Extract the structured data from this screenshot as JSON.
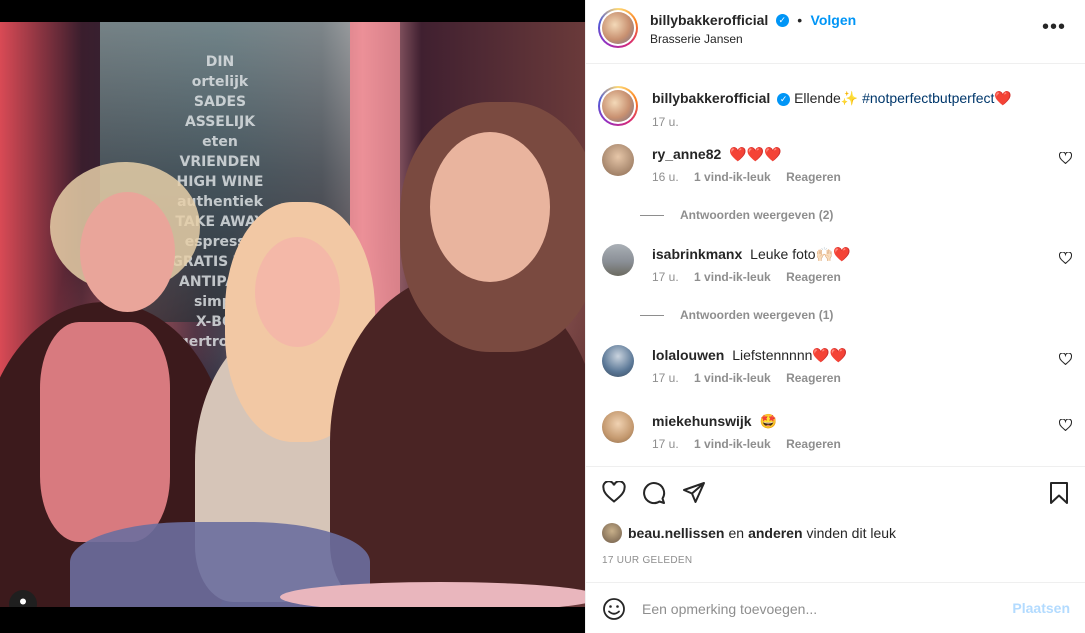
{
  "photo": {
    "window_text": [
      "DIN",
      "ortelijk",
      "SADES",
      "ASSELIJK",
      "eten",
      "VRIENDEN",
      "HIGH WINE",
      "authentiek",
      "TAKE AWAY",
      "espresso",
      "GRATIS WIFI",
      "ANTIPASTI",
      "simpel",
      "X-BOX",
      "gertrouwd"
    ],
    "user_tag_icon": "user-icon"
  },
  "header": {
    "username": "billybakkerofficial",
    "verified_icon": "verified-badge-icon",
    "follow_label": "Volgen",
    "location": "Brasserie Jansen",
    "more_icon": "more-options-icon"
  },
  "caption": {
    "username": "billybakkerofficial",
    "text": "Ellende✨",
    "hashtag": "#notperfectbutperfect❤️",
    "time": "17 u."
  },
  "comments": [
    {
      "username": "ry_anne82",
      "text": "❤️❤️❤️",
      "time": "16 u.",
      "likes": "1 vind-ik-leuk",
      "reply": "Reageren",
      "replies": "Antwoorden weergeven (2)",
      "avatar_color": "#b89a80"
    },
    {
      "username": "isabrinkmanx",
      "text": "Leuke foto🙌🏻❤️",
      "time": "17 u.",
      "likes": "1 vind-ik-leuk",
      "reply": "Reageren",
      "replies": "Antwoorden weergeven (1)",
      "avatar_color": "#8a8f96"
    },
    {
      "username": "lolalouwen",
      "text": "Liefstennnnn❤️❤️",
      "time": "17 u.",
      "likes": "1 vind-ik-leuk",
      "reply": "Reageren",
      "replies": "",
      "avatar_color": "#5a7796"
    },
    {
      "username": "miekehunswijk",
      "text": "🤩",
      "time": "17 u.",
      "likes": "1 vind-ik-leuk",
      "reply": "Reageren",
      "replies": "",
      "avatar_color": "#d9b391"
    }
  ],
  "actions": {
    "like_icon": "heart-icon",
    "comment_icon": "comment-icon",
    "share_icon": "share-icon",
    "save_icon": "bookmark-icon",
    "liked_by_user": "beau.nellissen",
    "liked_by_connector": "en",
    "liked_by_others": "anderen",
    "liked_by_suffix": "vinden dit leuk",
    "date": "17 UUR GELEDEN"
  },
  "add_comment": {
    "emoji_icon": "emoji-icon",
    "placeholder": "Een opmerking toevoegen...",
    "post_label": "Plaatsen"
  },
  "colors": {
    "accent": "#0095f6",
    "post_disabled": "#b3dbff",
    "muted": "#8e8e8e",
    "hashtag": "#00376b"
  }
}
